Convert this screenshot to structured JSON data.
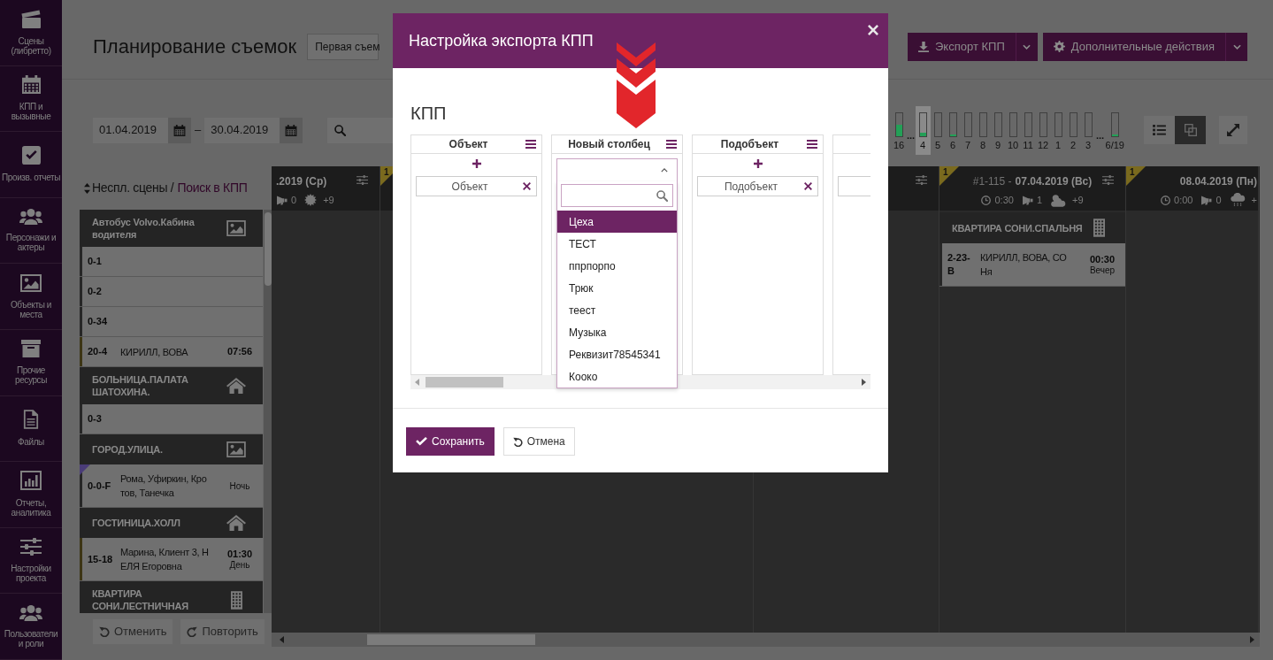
{
  "sidebar": {
    "items": [
      {
        "label": "Сцены (либретто)"
      },
      {
        "label": "КПП и вызывные"
      },
      {
        "label": "Произв. отчеты"
      },
      {
        "label": "Персонажи и актеры"
      },
      {
        "label": "Объекты и места"
      },
      {
        "label": "Прочие ресурсы"
      },
      {
        "label": "Файлы"
      },
      {
        "label": "Отчеты, аналитика"
      },
      {
        "label": "Настройки проекта"
      },
      {
        "label": "Пользователи и роли"
      }
    ]
  },
  "header": {
    "title": "Планирование съемок",
    "shoot_select": "Первая съем",
    "actions": [
      {
        "kind": "export",
        "label": "Экспорт КПП"
      },
      {
        "kind": "settings",
        "label": "Дополнительные действия"
      }
    ]
  },
  "toolbar": {
    "date_from": "01.04.2019",
    "date_separator": "–",
    "date_to": "30.04.2019",
    "months": [
      {
        "kind": "bar",
        "label": "16",
        "level": 0.5,
        "selected": false
      },
      {
        "kind": "gap",
        "label": "..."
      },
      {
        "kind": "bar",
        "label": "4",
        "level": 0.12,
        "selected": true
      },
      {
        "kind": "bar",
        "label": "5",
        "selected": false
      },
      {
        "kind": "bar",
        "label": "6",
        "level": 0.05,
        "selected": false
      },
      {
        "kind": "bar",
        "label": "7",
        "selected": false
      },
      {
        "kind": "bar",
        "label": "8",
        "selected": false
      },
      {
        "kind": "bar",
        "label": "9",
        "selected": false
      },
      {
        "kind": "bar",
        "label": "10",
        "selected": false
      },
      {
        "kind": "bar",
        "label": "11",
        "selected": false
      },
      {
        "kind": "bar",
        "label": "12",
        "selected": false
      },
      {
        "kind": "bar",
        "label": "1",
        "selected": false
      },
      {
        "kind": "bar",
        "label": "2",
        "selected": false
      },
      {
        "kind": "bar",
        "label": "3",
        "selected": false
      },
      {
        "kind": "gap",
        "label": "..."
      },
      {
        "kind": "bar",
        "label": "6/19",
        "level": 0.05,
        "selected": false
      }
    ],
    "views": [
      {
        "kind": "list",
        "selected": false
      },
      {
        "kind": "cards",
        "selected": true
      }
    ]
  },
  "unplanned": {
    "title": "Неспл. сцены /",
    "link": "Поиск в КПП",
    "groups": [
      {
        "kind": "picture",
        "title": "Автобус Volvo.Кабина водителя",
        "scenes": [
          {
            "number": "0-1",
            "color": "#262626",
            "corner_mark": false
          },
          {
            "number": "0-2",
            "color": "#262626",
            "corner_mark": false
          },
          {
            "number": "0-34",
            "color": "#262626",
            "corner_mark": false
          },
          {
            "number": "20-4",
            "cast": "КИРИЛЛ, ВОВА",
            "time": "07:56",
            "color": "#3d3515",
            "corner_mark": false
          }
        ]
      },
      {
        "kind": "home",
        "title": "БОЛЬНИЦА.ПАЛАТА ШАТОХИНА.",
        "scenes": [
          {
            "number": "0-3",
            "color": "#262626",
            "corner_mark": false
          }
        ]
      },
      {
        "kind": "picture",
        "title": "ГОРОД.УЛИЦА.",
        "scenes": [
          {
            "number": "0-0-F",
            "cast": "Рома, Уфиркин, Кротов, Танечка",
            "daypart": "Ночь",
            "color": "#262626",
            "corner_mark": true
          }
        ]
      },
      {
        "kind": "home",
        "title": "ГОСТИНИЦА.ХОЛЛ",
        "scenes": [
          {
            "number": "15-18",
            "cast": "Марина, Клиент 3, НЕЛЯ Егоровна",
            "time": "01:30",
            "daypart": "День",
            "color": "#3d3515",
            "corner_mark": false
          }
        ]
      },
      {
        "kind": "building",
        "title": "КВАРТИРА СОНИ.ЛЕСТНИЧНАЯ"
      }
    ],
    "actions": [
      {
        "kind": "undo",
        "label": "Отменить",
        "disabled": true
      },
      {
        "kind": "redo",
        "label": "Повторить",
        "disabled": true
      }
    ]
  },
  "schedule": {
    "days": [
      {
        "date": ".2019 (Ср)",
        "calls": "0",
        "weather": {
          "kind": "sun"
        },
        "temperature": "+9",
        "settings": true
      },
      {
        "badge": "1",
        "settings": false
      },
      {
        "settings": true
      },
      {
        "badge": "1",
        "prefix": "#1-115 -",
        "date": "07.04.2019 (Вс)",
        "time": "0:30",
        "calls": "1",
        "weather": {
          "kind": "cloud-sun"
        },
        "temperature": "+9",
        "settings": true,
        "groups": [
          {
            "kind": "building",
            "title": "КВАРТИРА СОНИ.СПАЛЬНЯ",
            "scenes": [
              {
                "number": "2-23-В",
                "cast": "КИРИЛЛ, ВОВА, СОНя",
                "time": "00:30",
                "daypart": "Вечер",
                "color": "#262626",
                "corner_mark": false
              }
            ]
          }
        ]
      },
      {
        "badge": "1",
        "date": "08.04.2019 (Пн)",
        "time": "0:00",
        "calls": "0",
        "weather": {
          "kind": "rain"
        },
        "temperature": "+",
        "settings": false
      }
    ]
  },
  "modal": {
    "title": "Настройка экспорта КПП",
    "section": "КПП",
    "columns": [
      {
        "kind": "chips",
        "title": "Объект",
        "chips": [
          {
            "label": "Объект"
          }
        ]
      },
      {
        "kind": "select",
        "title": "Новый столбец",
        "expanded": true,
        "options": [
          {
            "label": "Цеха",
            "selected": true
          },
          {
            "label": "ТЕСТ",
            "selected": false
          },
          {
            "label": "ппрпорпо",
            "selected": false
          },
          {
            "label": "Трюк",
            "selected": false
          },
          {
            "label": "теест",
            "selected": false
          },
          {
            "label": "Музыка",
            "selected": false
          },
          {
            "label": "Реквизит78545341",
            "selected": false
          },
          {
            "label": "Кооко",
            "selected": false
          }
        ]
      },
      {
        "kind": "chips",
        "title": "Подобъект",
        "chips": [
          {
            "label": "Подобъект"
          }
        ]
      },
      {
        "kind": "clipped"
      }
    ],
    "buttons": [
      {
        "kind": "primary",
        "label": "Сохранить"
      },
      {
        "kind": "secondary",
        "label": "Отмена"
      }
    ]
  }
}
